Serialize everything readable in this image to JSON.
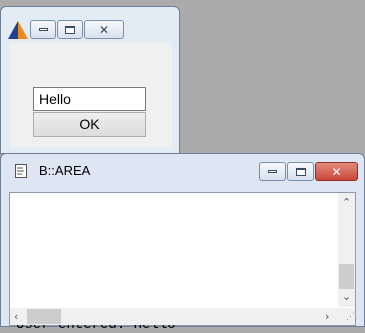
{
  "dialog": {
    "input_value": "Hello",
    "ok_label": "OK"
  },
  "console": {
    "title": "B::AREA",
    "output_line": "User entered: Hello"
  },
  "icons": {
    "minimize": "minimize-icon",
    "maximize": "maximize-icon",
    "close": "close-icon",
    "app": "triangle-app-icon",
    "document": "document-icon"
  },
  "colors": {
    "close_button": "#c9473a",
    "desktop": "#ababab",
    "frame": "#dbe5f1"
  }
}
